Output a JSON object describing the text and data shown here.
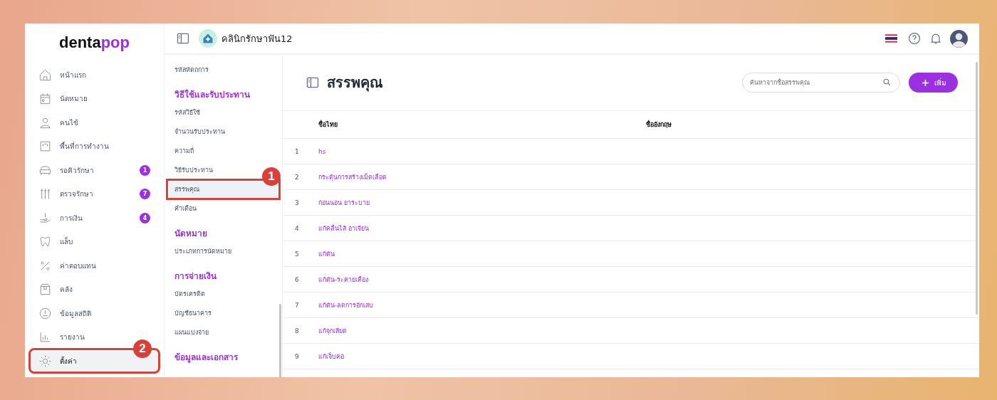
{
  "logo": {
    "part_1": "denta",
    "part_2": "pop"
  },
  "sidebar": {
    "items": [
      {
        "label": "หน้าแรก",
        "selected": false
      },
      {
        "label": "นัดหมาย",
        "selected": false
      },
      {
        "label": "คนไข้",
        "selected": false
      },
      {
        "label": "พื้นที่การทำงาน",
        "selected": false
      },
      {
        "label": "รอคิวรักษา",
        "selected": false,
        "badge": "1"
      },
      {
        "label": "ตรวจรักษา",
        "selected": false,
        "badge": "7"
      },
      {
        "label": "การเงิน",
        "selected": false,
        "badge": "4"
      },
      {
        "label": "แล็บ",
        "selected": false
      },
      {
        "label": "ค่าตอบแทน",
        "selected": false
      },
      {
        "label": "คลัง",
        "selected": false
      },
      {
        "label": "ข้อมูลสถิติ",
        "selected": false
      },
      {
        "label": "รายงาน",
        "selected": false
      },
      {
        "label": "ตั้งค่า",
        "selected": true,
        "callout": "2"
      }
    ]
  },
  "header": {
    "clinic": "คลินิกรักษาฟัน12"
  },
  "settings_menu": [
    {
      "kind": "item",
      "label": "รหัสหัตถการ",
      "selected": false
    },
    {
      "kind": "section",
      "label": "วิธีใช้และรับประทาน"
    },
    {
      "kind": "item",
      "label": "รหัสวิธีใช้",
      "selected": false
    },
    {
      "kind": "item",
      "label": "จำนวนรับประทาน",
      "selected": false
    },
    {
      "kind": "item",
      "label": "ความถี่",
      "selected": false
    },
    {
      "kind": "item",
      "label": "วิธีรับประทาน",
      "selected": false
    },
    {
      "kind": "item",
      "label": "สรรพคุณ",
      "selected": true,
      "callout": "1"
    },
    {
      "kind": "item",
      "label": "คำเตือน",
      "selected": false
    },
    {
      "kind": "section",
      "label": "นัดหมาย"
    },
    {
      "kind": "item",
      "label": "ประเภทการนัดหมาย",
      "selected": false
    },
    {
      "kind": "section",
      "label": "การจ่ายเงิน"
    },
    {
      "kind": "item",
      "label": "บัตรเครดิต",
      "selected": false
    },
    {
      "kind": "item",
      "label": "บัญชีธนาคาร",
      "selected": false
    },
    {
      "kind": "item",
      "label": "แผนแบ่งจ่าย",
      "selected": false
    },
    {
      "kind": "section",
      "label": "ข้อมูลและเอกสาร"
    }
  ],
  "page": {
    "title": "สรรพคุณ",
    "search": {
      "placeholder": "ค้นหาจากชื่อสรรพคุณ"
    },
    "add_button": "เพิ่ม"
  },
  "table": {
    "columns": [
      "ชื่อไทย",
      "ชื่ออังกฤษ"
    ],
    "rows": [
      {
        "no": "1",
        "thai": "hs"
      },
      {
        "no": "2",
        "thai": "กระตุ้นการสร้างเม็ดเลือด"
      },
      {
        "no": "3",
        "thai": "ก่อนนอน ยาระบาย"
      },
      {
        "no": "4",
        "thai": "แก้คลื่นไส้ อาเจียน"
      },
      {
        "no": "5",
        "thai": "แก้ดัน"
      },
      {
        "no": "6",
        "thai": "แก้ดัน-ระคายเคือง"
      },
      {
        "no": "7",
        "thai": "แก้ดัน-ลดการอักเสบ"
      },
      {
        "no": "8",
        "thai": "แก้จุกเสียด"
      },
      {
        "no": "9",
        "thai": "แก้เจ็บคอ"
      }
    ]
  }
}
